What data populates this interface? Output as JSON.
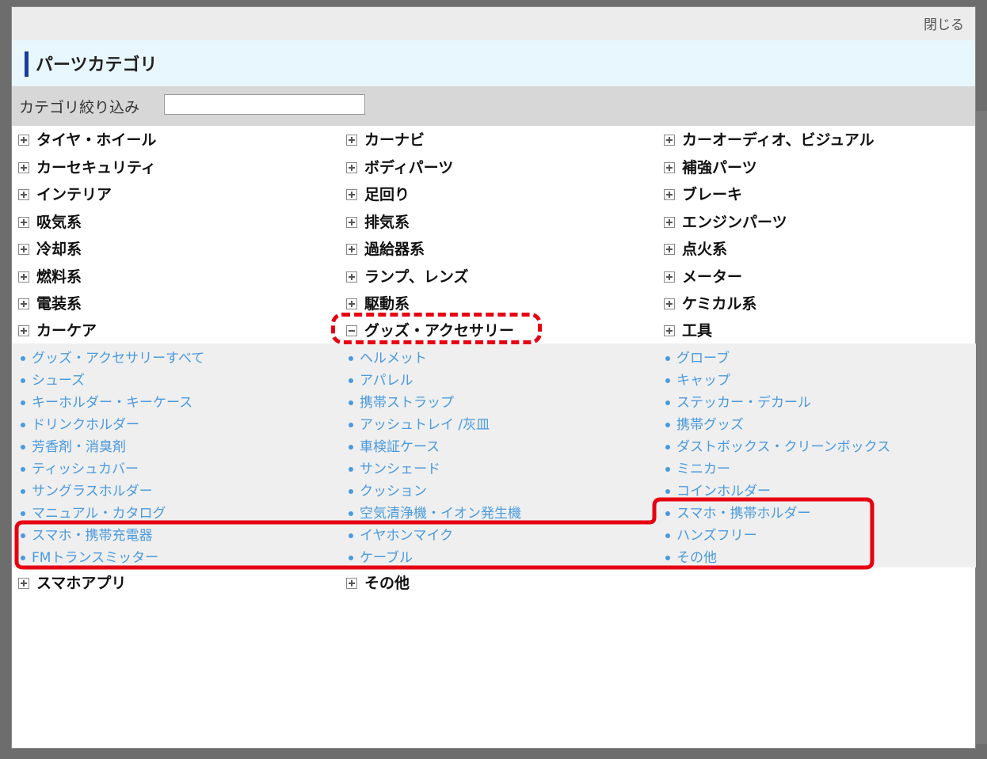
{
  "modal": {
    "close_label": "閉じる",
    "title": "パーツカテゴリ",
    "filter_label": "カテゴリ絞り込み",
    "filter_value": ""
  },
  "categories": {
    "col1": [
      "タイヤ・ホイール",
      "カーセキュリティ",
      "インテリア",
      "吸気系",
      "冷却系",
      "燃料系",
      "電装系",
      "カーケア"
    ],
    "col2": [
      "カーナビ",
      "ボディパーツ",
      "足回り",
      "排気系",
      "過給器系",
      "ランプ、レンズ",
      "駆動系",
      "グッズ・アクセサリー"
    ],
    "col3": [
      "カーオーディオ、ビジュアル",
      "補強パーツ",
      "ブレーキ",
      "エンジンパーツ",
      "点火系",
      "メーター",
      "ケミカル系",
      "工具"
    ],
    "bottom": [
      "スマホアプリ",
      "その他"
    ]
  },
  "subcategories": {
    "col1": [
      "グッズ・アクセサリーすべて",
      "シューズ",
      "キーホルダー・キーケース",
      "ドリンクホルダー",
      "芳香剤・消臭剤",
      "ティッシュカバー",
      "サングラスホルダー",
      "マニュアル・カタログ",
      "スマホ・携帯充電器",
      "FMトランスミッター"
    ],
    "col2": [
      "ヘルメット",
      "アパレル",
      "携帯ストラップ",
      "アッシュトレイ /灰皿",
      "車検証ケース",
      "サンシェード",
      "クッション",
      "空気清浄機・イオン発生機",
      "イヤホンマイク",
      "ケーブル"
    ],
    "col3": [
      "グローブ",
      "キャップ",
      "ステッカー・デカール",
      "携帯グッズ",
      "ダストボックス・クリーンボックス",
      "ミニカー",
      "コインホルダー",
      "スマホ・携帯ホルダー",
      "ハンズフリー",
      "その他"
    ]
  },
  "colors": {
    "link": "#4a9ade",
    "highlight": "#e60012",
    "title_accent": "#1a3c9a"
  }
}
